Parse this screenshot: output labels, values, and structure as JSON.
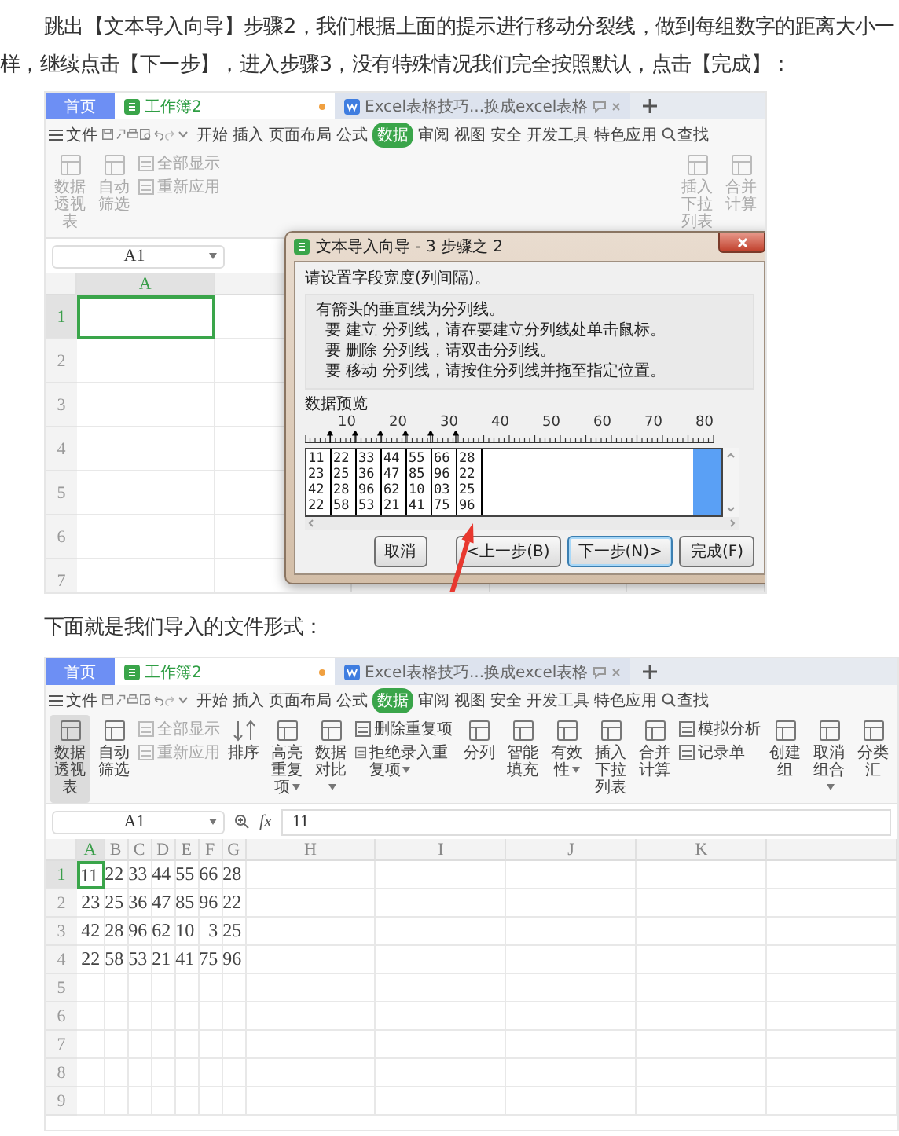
{
  "intro": "跳出【文本导入向导】步骤2，我们根据上面的提示进行移动分裂线，做到每组数字的距离大小一样，继续点击【下一步】，进入步骤3，没有特殊情况我们完全按照默认，点击【完成】：",
  "screenshot_1": {
    "tabs": [
      {
        "label": "首页",
        "kind": "home",
        "selected": false,
        "modified": false
      },
      {
        "label": "工作簿2",
        "kind": "sheet",
        "selected": true,
        "modified": true
      },
      {
        "label": "Excel表格技巧...换成excel表格",
        "kind": "doc",
        "selected": false,
        "modified": false
      }
    ],
    "menu": {
      "file": "文件",
      "items": [
        {
          "label": "开始",
          "selected": false
        },
        {
          "label": "插入",
          "selected": false
        },
        {
          "label": "页面布局",
          "selected": false
        },
        {
          "label": "公式",
          "selected": false
        },
        {
          "label": "数据",
          "selected": true
        },
        {
          "label": "审阅",
          "selected": false
        },
        {
          "label": "视图",
          "selected": false
        },
        {
          "label": "安全",
          "selected": false
        },
        {
          "label": "开发工具",
          "selected": false
        },
        {
          "label": "特色应用",
          "selected": false
        }
      ],
      "search": "查找"
    },
    "ribbon": [
      {
        "kind": "large",
        "label": "数据透视表",
        "selected": false,
        "disabled": true,
        "dropdown": false
      },
      {
        "kind": "large",
        "label": "自动筛选",
        "selected": false,
        "disabled": true,
        "dropdown": false
      },
      {
        "kind": "stack",
        "items": [
          {
            "label": "全部显示",
            "disabled": true,
            "dropdown": false
          },
          {
            "label": "重新应用",
            "disabled": true,
            "dropdown": false
          }
        ]
      }
    ],
    "ribbon_right": [
      {
        "kind": "large",
        "label": "插入下拉列表",
        "selected": false,
        "disabled": true,
        "dropdown": false
      },
      {
        "kind": "large",
        "label": "合并计算",
        "selected": false,
        "disabled": true,
        "dropdown": false
      }
    ],
    "name_box": "A1",
    "columns": [
      {
        "label": "A",
        "selected": true
      }
    ],
    "rows": [
      {
        "label": "1",
        "selected": true,
        "cells": [
          {
            "selected": true
          }
        ]
      },
      {
        "label": "2",
        "selected": false
      },
      {
        "label": "3",
        "selected": false
      },
      {
        "label": "4",
        "selected": false
      },
      {
        "label": "5",
        "selected": false
      },
      {
        "label": "6",
        "selected": false
      },
      {
        "label": "7",
        "selected": false
      }
    ],
    "dialog": {
      "title": "文本导入向导 - 3 步骤之 2",
      "prompt": "请设置字段宽度(列间隔)。",
      "hints": [
        "有箭头的垂直线为分列线。",
        "要 建立 分列线，请在要建立分列线处单击鼠标。",
        "要 删除 分列线，请双击分列线。",
        "要 移动 分列线，请按住分列线并拖至指定位置。"
      ],
      "preview_label": "数据预览",
      "ruler_labels": [
        "10",
        "20",
        "30",
        "40",
        "50",
        "60",
        "70",
        "80"
      ],
      "preview_rows": [
        [
          "11",
          "22",
          "33",
          "44",
          "55",
          "66",
          "28"
        ],
        [
          "23",
          "25",
          "36",
          "47",
          "85",
          "96",
          "22"
        ],
        [
          "42",
          "28",
          "96",
          "62",
          "10",
          "03",
          "25"
        ],
        [
          "22",
          "58",
          "53",
          "21",
          "41",
          "75",
          "96"
        ]
      ],
      "buttons": [
        {
          "label": "取消",
          "focused": false
        },
        {
          "label": "<上一步(B)",
          "focused": false
        },
        {
          "label": "下一步(N)>",
          "focused": true
        },
        {
          "label": "完成(F)",
          "focused": false
        }
      ]
    }
  },
  "caption": "下面就是我们导入的文件形式：",
  "screenshot_2": {
    "tabs": [
      {
        "label": "首页",
        "kind": "home",
        "selected": false,
        "modified": false
      },
      {
        "label": "工作簿2",
        "kind": "sheet",
        "selected": true,
        "modified": true
      },
      {
        "label": "Excel表格技巧...换成excel表格",
        "kind": "doc",
        "selected": false,
        "modified": false
      }
    ],
    "menu": {
      "file": "文件",
      "items": [
        {
          "label": "开始",
          "selected": false
        },
        {
          "label": "插入",
          "selected": false
        },
        {
          "label": "页面布局",
          "selected": false
        },
        {
          "label": "公式",
          "selected": false
        },
        {
          "label": "数据",
          "selected": true
        },
        {
          "label": "审阅",
          "selected": false
        },
        {
          "label": "视图",
          "selected": false
        },
        {
          "label": "安全",
          "selected": false
        },
        {
          "label": "开发工具",
          "selected": false
        },
        {
          "label": "特色应用",
          "selected": false
        }
      ],
      "search": "查找"
    },
    "ribbon": [
      {
        "kind": "large",
        "label": "数据透视表",
        "selected": true,
        "disabled": false,
        "dropdown": false
      },
      {
        "kind": "large",
        "label": "自动筛选",
        "selected": false,
        "disabled": false,
        "dropdown": false
      },
      {
        "kind": "stack",
        "items": [
          {
            "label": "全部显示",
            "disabled": true,
            "dropdown": false
          },
          {
            "label": "重新应用",
            "disabled": true,
            "dropdown": false
          }
        ]
      },
      {
        "kind": "sort",
        "label": "排序",
        "selected": false,
        "disabled": false,
        "dropdown": false
      },
      {
        "kind": "large",
        "label": "高亮重复项",
        "selected": false,
        "disabled": false,
        "dropdown": true
      },
      {
        "kind": "large",
        "label": "数据对比",
        "selected": false,
        "disabled": false,
        "dropdown": true
      },
      {
        "kind": "stack",
        "items": [
          {
            "label": "删除重复项",
            "disabled": false,
            "dropdown": false
          },
          {
            "label": "拒绝录入重复项",
            "disabled": false,
            "dropdown": true
          }
        ]
      },
      {
        "kind": "large",
        "label": "分列",
        "selected": false,
        "disabled": false,
        "dropdown": false
      },
      {
        "kind": "large",
        "label": "智能填充",
        "selected": false,
        "disabled": false,
        "dropdown": false
      },
      {
        "kind": "large",
        "label": "有效性",
        "selected": false,
        "disabled": false,
        "dropdown": true
      },
      {
        "kind": "large",
        "label": "插入下拉列表",
        "selected": false,
        "disabled": false,
        "dropdown": false
      },
      {
        "kind": "large",
        "label": "合并计算",
        "selected": false,
        "disabled": false,
        "dropdown": false
      },
      {
        "kind": "stack",
        "items": [
          {
            "label": "模拟分析",
            "disabled": false,
            "dropdown": false
          },
          {
            "label": "记录单",
            "disabled": false,
            "dropdown": false
          }
        ]
      },
      {
        "kind": "large",
        "label": "创建组",
        "selected": false,
        "disabled": false,
        "dropdown": false
      },
      {
        "kind": "large",
        "label": "取消组合",
        "selected": false,
        "disabled": false,
        "dropdown": true
      },
      {
        "kind": "large",
        "label": "分类汇",
        "selected": false,
        "disabled": false,
        "dropdown": false
      }
    ],
    "name_box": "A1",
    "formula": {
      "fx": "fx",
      "value": "11"
    },
    "columns": [
      {
        "label": "A",
        "selected": true
      },
      {
        "label": "B",
        "selected": false
      },
      {
        "label": "C",
        "selected": false
      },
      {
        "label": "D",
        "selected": false
      },
      {
        "label": "E",
        "selected": false
      },
      {
        "label": "F",
        "selected": false
      },
      {
        "label": "G",
        "selected": false
      },
      {
        "label": "H",
        "selected": false
      },
      {
        "label": "I",
        "selected": false
      },
      {
        "label": "J",
        "selected": false
      },
      {
        "label": "K",
        "selected": false
      }
    ],
    "rows": [
      {
        "label": "1",
        "selected": true,
        "cells": [
          {
            "value": "11",
            "selected": true
          },
          {
            "value": "22",
            "selected": false
          },
          {
            "value": "33",
            "selected": false
          },
          {
            "value": "44",
            "selected": false
          },
          {
            "value": "55",
            "selected": false
          },
          {
            "value": "66",
            "selected": false
          },
          {
            "value": "28",
            "selected": false
          }
        ]
      },
      {
        "label": "2",
        "selected": false,
        "cells": [
          {
            "value": "23",
            "selected": false
          },
          {
            "value": "25",
            "selected": false
          },
          {
            "value": "36",
            "selected": false
          },
          {
            "value": "47",
            "selected": false
          },
          {
            "value": "85",
            "selected": false
          },
          {
            "value": "96",
            "selected": false
          },
          {
            "value": "22",
            "selected": false
          }
        ]
      },
      {
        "label": "3",
        "selected": false,
        "cells": [
          {
            "value": "42",
            "selected": false
          },
          {
            "value": "28",
            "selected": false
          },
          {
            "value": "96",
            "selected": false
          },
          {
            "value": "62",
            "selected": false
          },
          {
            "value": "10",
            "selected": false
          },
          {
            "value": "3",
            "selected": false
          },
          {
            "value": "25",
            "selected": false
          }
        ]
      },
      {
        "label": "4",
        "selected": false,
        "cells": [
          {
            "value": "22",
            "selected": false
          },
          {
            "value": "58",
            "selected": false
          },
          {
            "value": "53",
            "selected": false
          },
          {
            "value": "21",
            "selected": false
          },
          {
            "value": "41",
            "selected": false
          },
          {
            "value": "75",
            "selected": false
          },
          {
            "value": "96",
            "selected": false
          }
        ]
      },
      {
        "label": "5",
        "selected": false
      },
      {
        "label": "6",
        "selected": false
      },
      {
        "label": "7",
        "selected": false
      },
      {
        "label": "8",
        "selected": false
      },
      {
        "label": "9",
        "selected": false
      }
    ]
  }
}
